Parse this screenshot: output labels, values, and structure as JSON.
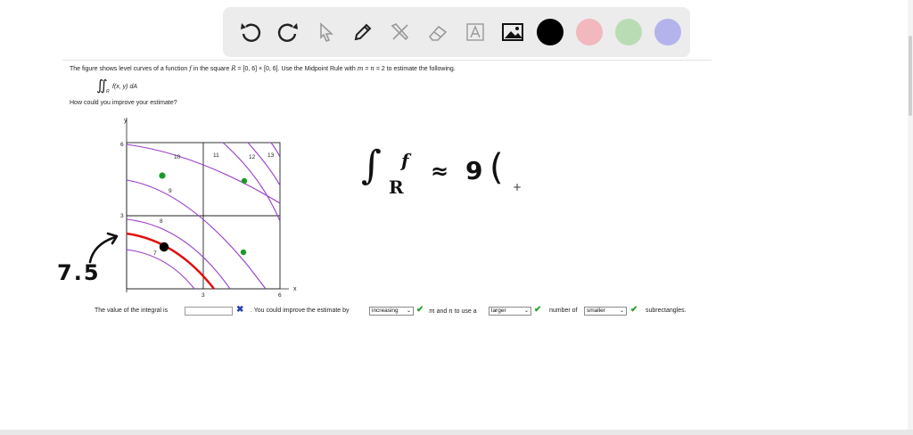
{
  "toolbar": {
    "tools": [
      "undo-icon",
      "redo-icon",
      "select-pointer-icon",
      "pen-icon",
      "tools-icon",
      "eraser-icon",
      "text-icon",
      "image-icon"
    ],
    "colors": [
      "#000000",
      "#f2b8bd",
      "#b9dcb5",
      "#b4b3ec"
    ]
  },
  "problem": {
    "p1": "The figure shows level curves of a function",
    "f": "f",
    "p2": "in the square",
    "R": "R",
    "p3": "= [0, 6] × [0, 6]. Use the Midpoint Rule with",
    "m": "m",
    "p4": "=",
    "n": "n",
    "p5": "= 2 to estimate the following.",
    "integral_symbol": "∬",
    "integral_sub": "R",
    "integrand": "f(x, y) dA",
    "question": "How could you improve your estimate?"
  },
  "graph": {
    "y_axis_label": "y",
    "x_axis_label": "x",
    "y_ticks": [
      "6",
      "3"
    ],
    "x_ticks": [
      "3",
      "6"
    ],
    "curve_labels": [
      "10",
      "11",
      "12",
      "13",
      "9",
      "8",
      "7"
    ],
    "curve_color": "#9a3cc8",
    "highlight_color": "#e01010",
    "midpoint_color": "#1a9a2a"
  },
  "annotations": {
    "left_number": "7.5",
    "integral_sym": "∫",
    "sub_R": "R",
    "sup_f": "f",
    "approx": "≈",
    "nine": "9",
    "paren": "("
  },
  "answer": {
    "t1": "The value of the integral is",
    "input_value": "",
    "t2": ". You could improve the estimate by",
    "sel1": "increasing",
    "t3a": "m",
    "t3b": "and",
    "t3c": "n",
    "t3d": "to use a",
    "sel2": "larger",
    "t4": "number of",
    "sel3": "smaller",
    "t5": "subrectangles.",
    "cross": "✖",
    "check": "✔",
    "caret": "⌄"
  }
}
